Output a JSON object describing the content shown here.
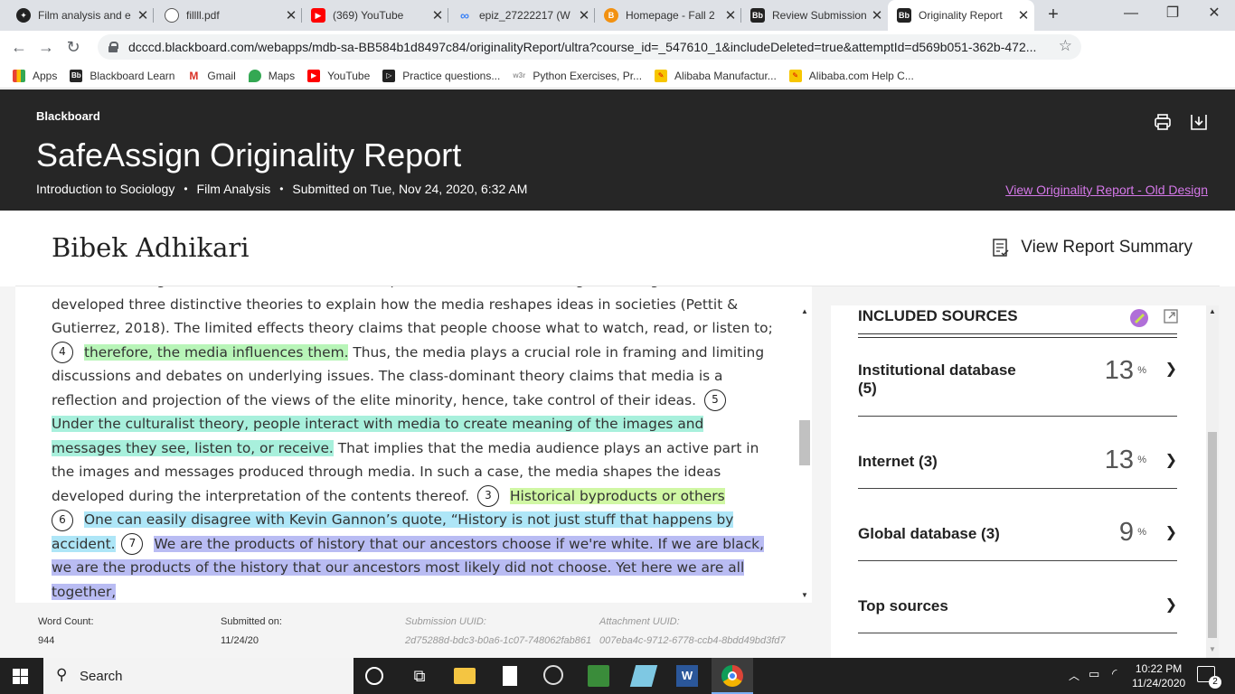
{
  "browser": {
    "tabs": [
      {
        "title": "Film analysis and e",
        "icon": "openai-icon"
      },
      {
        "title": "fillll.pdf",
        "icon": "globe-icon"
      },
      {
        "title": "(369) YouTube",
        "icon": "youtube-icon"
      },
      {
        "title": "epiz_27222217 (W",
        "icon": "infinity-icon"
      },
      {
        "title": "Homepage - Fall 2",
        "icon": "b-orange-icon"
      },
      {
        "title": "Review Submission",
        "icon": "blackboard-icon"
      },
      {
        "title": "Originality Report",
        "icon": "blackboard-icon"
      }
    ],
    "url": "dcccd.blackboard.com/webapps/mdb-sa-BB584b1d8497c84/originalityReport/ultra?course_id=_547610_1&includeDeleted=true&attemptId=d569b051-362b-472...",
    "bookmarks": [
      {
        "label": "Apps",
        "color": "#e94235"
      },
      {
        "label": "Blackboard Learn",
        "color": "#262626"
      },
      {
        "label": "Gmail",
        "color": "#d93025"
      },
      {
        "label": "Maps",
        "color": "#34a853"
      },
      {
        "label": "YouTube",
        "color": "#ff0000"
      },
      {
        "label": "Practice questions...",
        "color": "#222222"
      },
      {
        "label": "Python Exercises, Pr...",
        "color": "#999999"
      },
      {
        "label": "Alibaba Manufactur...",
        "color": "#f7c600"
      },
      {
        "label": "Alibaba.com Help C...",
        "color": "#f7c600"
      }
    ]
  },
  "header": {
    "brand": "Blackboard",
    "title": "SafeAssign Originality Report",
    "course": "Introduction to Sociology",
    "assignment": "Film Analysis",
    "submitted": "Submitted on Tue, Nov 24, 2020, 6:32 AM",
    "old_design_link": "View Originality Report - Old Design"
  },
  "student": {
    "name": "Bibek Adhikari",
    "summary_label": "View Report Summary"
  },
  "document": {
    "p0": "televisions, magazines, radios, and other media platforms in societal settings. Sociologists have developed three distinctive theories to explain how the media reshapes ideas in societies (Pettit & Gutierrez, 2018). The limited effects theory claims that people choose what to watch, read, or listen to;",
    "n4": "4",
    "s4": "therefore, the media influences them.",
    "p1": " Thus, the media plays a crucial role in framing and limiting discussions and debates on underlying issues. The class-dominant theory claims that media is a reflection and projection of the views of the elite minority, hence, take control of their ideas.",
    "n5": "5",
    "s5": "Under the culturalist theory, people interact with media to create meaning of the images and messages they see, listen to, or receive.",
    "p2": " That implies that the media audience plays an active part in the images and messages produced through media. In such a case, the media shapes the ideas developed during the interpretation of the contents thereof.",
    "n3": "3",
    "s3": "Historical byproducts or others",
    "n6": "6",
    "s6": "One can easily disagree with Kevin Gannon’s quote, “History is not just stuff that happens by accident.",
    "n7": "7",
    "s7": "We are the products of history that our ancestors choose if we're white. If we are black, we are the products of the history that our ancestors most likely did not choose. Yet here we are all together,"
  },
  "footer": {
    "word_count_label": "Word Count:",
    "word_count": "944",
    "submitted_label": "Submitted on:",
    "submitted": "11/24/20",
    "submission_uuid_label": "Submission UUID:",
    "submission_uuid": "2d75288d-bdc3-b0a6-1c07-748062fab861",
    "attachment_uuid_label": "Attachment UUID:",
    "attachment_uuid": "007eba4c-9712-6778-ccb4-8bdd49bd3fd7"
  },
  "sources": {
    "heading": "INCLUDED SOURCES",
    "items": [
      {
        "name": "Institutional database",
        "count": "(5)",
        "percent": "13",
        "unit": "%"
      },
      {
        "name": "Internet (3)",
        "percent": "13",
        "unit": "%"
      },
      {
        "name": "Global database (3)",
        "percent": "9",
        "unit": "%"
      },
      {
        "name": "Top sources"
      }
    ]
  },
  "taskbar": {
    "search_placeholder": "Search",
    "time": "10:22 PM",
    "date": "11/24/2020",
    "notifications": "2"
  }
}
